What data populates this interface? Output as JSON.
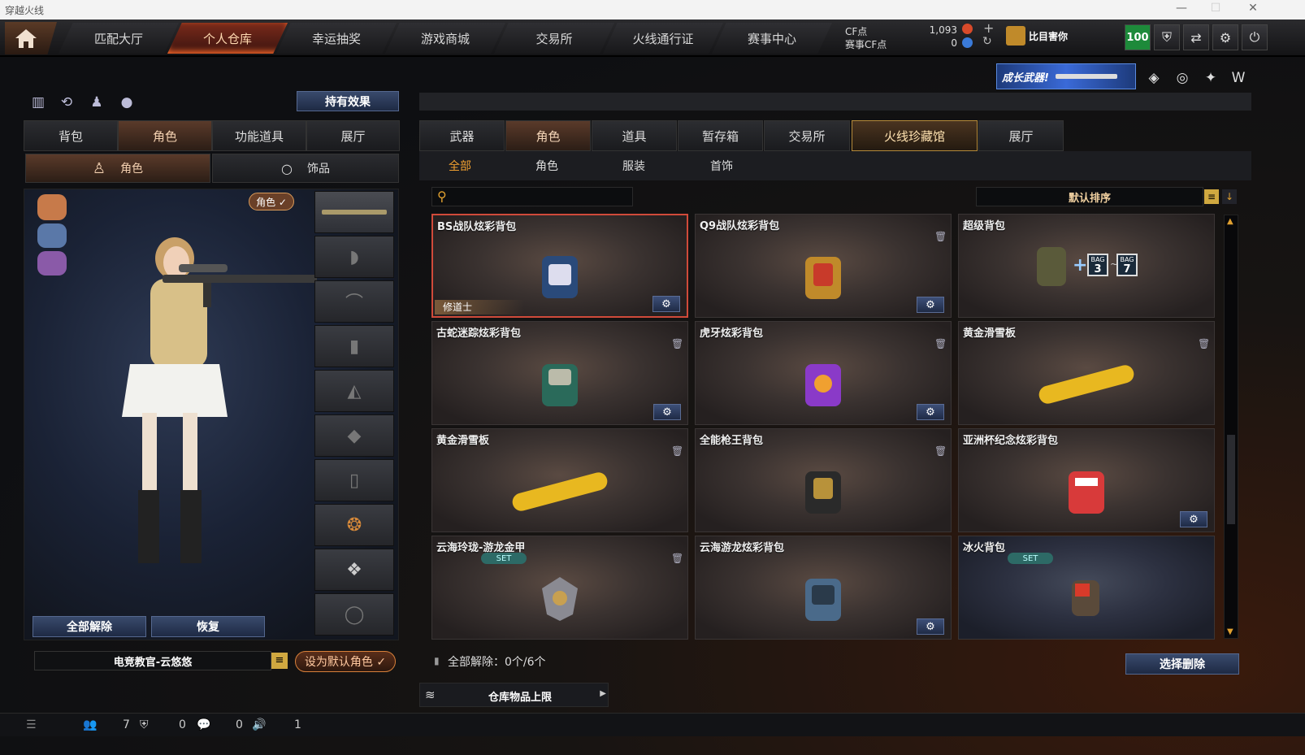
{
  "window": {
    "title": "穿越火线"
  },
  "nav": {
    "tabs": [
      "匹配大厅",
      "个人仓库",
      "幸运抽奖",
      "游戏商城",
      "交易所",
      "火线通行证",
      "赛事中心"
    ]
  },
  "currency": {
    "cf_label": "CF点",
    "cf_value": "1,093",
    "match_cf_label": "赛事CF点",
    "match_cf_value": "0"
  },
  "user": {
    "name": "比目害你",
    "level": "100"
  },
  "banner": {
    "text": "成长武器!"
  },
  "left": {
    "effects_button": "持有效果",
    "tabs": [
      "背包",
      "角色",
      "功能道具",
      "展厅"
    ],
    "subtabs": [
      "角色",
      "饰品"
    ],
    "role_badge": "角色 ✓",
    "unequip_all": "全部解除",
    "restore": "恢复",
    "character_name": "电竞教官-云悠悠",
    "set_default": "设为默认角色 ✓"
  },
  "right": {
    "tabs": [
      "武器",
      "角色",
      "道具",
      "暂存箱",
      "交易所",
      "火线珍藏馆",
      "展厅"
    ],
    "subtabs": [
      "全部",
      "角色",
      "服装",
      "首饰"
    ],
    "sort": "默认排序",
    "items": [
      {
        "name": "BS战队炫彩背包",
        "tag": "修道士",
        "gear": true,
        "trash": false
      },
      {
        "name": "Q9战队炫彩背包",
        "gear": true,
        "trash": true
      },
      {
        "name": "超级背包",
        "gear": false,
        "trash": false
      },
      {
        "name": "古蛇迷踪炫彩背包",
        "gear": true,
        "trash": true
      },
      {
        "name": "虎牙炫彩背包",
        "gear": true,
        "trash": true
      },
      {
        "name": "黄金滑雪板",
        "gear": false,
        "trash": true
      },
      {
        "name": "黄金滑雪板",
        "gear": false,
        "trash": true
      },
      {
        "name": "全能枪王背包",
        "gear": false,
        "trash": true
      },
      {
        "name": "亚洲杯纪念炫彩背包",
        "gear": true,
        "trash": false
      },
      {
        "name": "云海玲珑-游龙金甲",
        "set": "SET",
        "gear": false,
        "trash": true
      },
      {
        "name": "云海游龙炫彩背包",
        "gear": true,
        "trash": false
      },
      {
        "name": "冰火背包",
        "set": "SET",
        "gear": false,
        "trash": false
      }
    ],
    "super_bag_labels": [
      "BAG",
      "3",
      "BAG",
      "7"
    ],
    "unequip_count": "全部解除：0个/6个",
    "select_delete": "选择删除",
    "warehouse_limit": "仓库物品上限"
  },
  "bottom": {
    "counts": [
      "7",
      "0",
      "0",
      "1"
    ]
  }
}
